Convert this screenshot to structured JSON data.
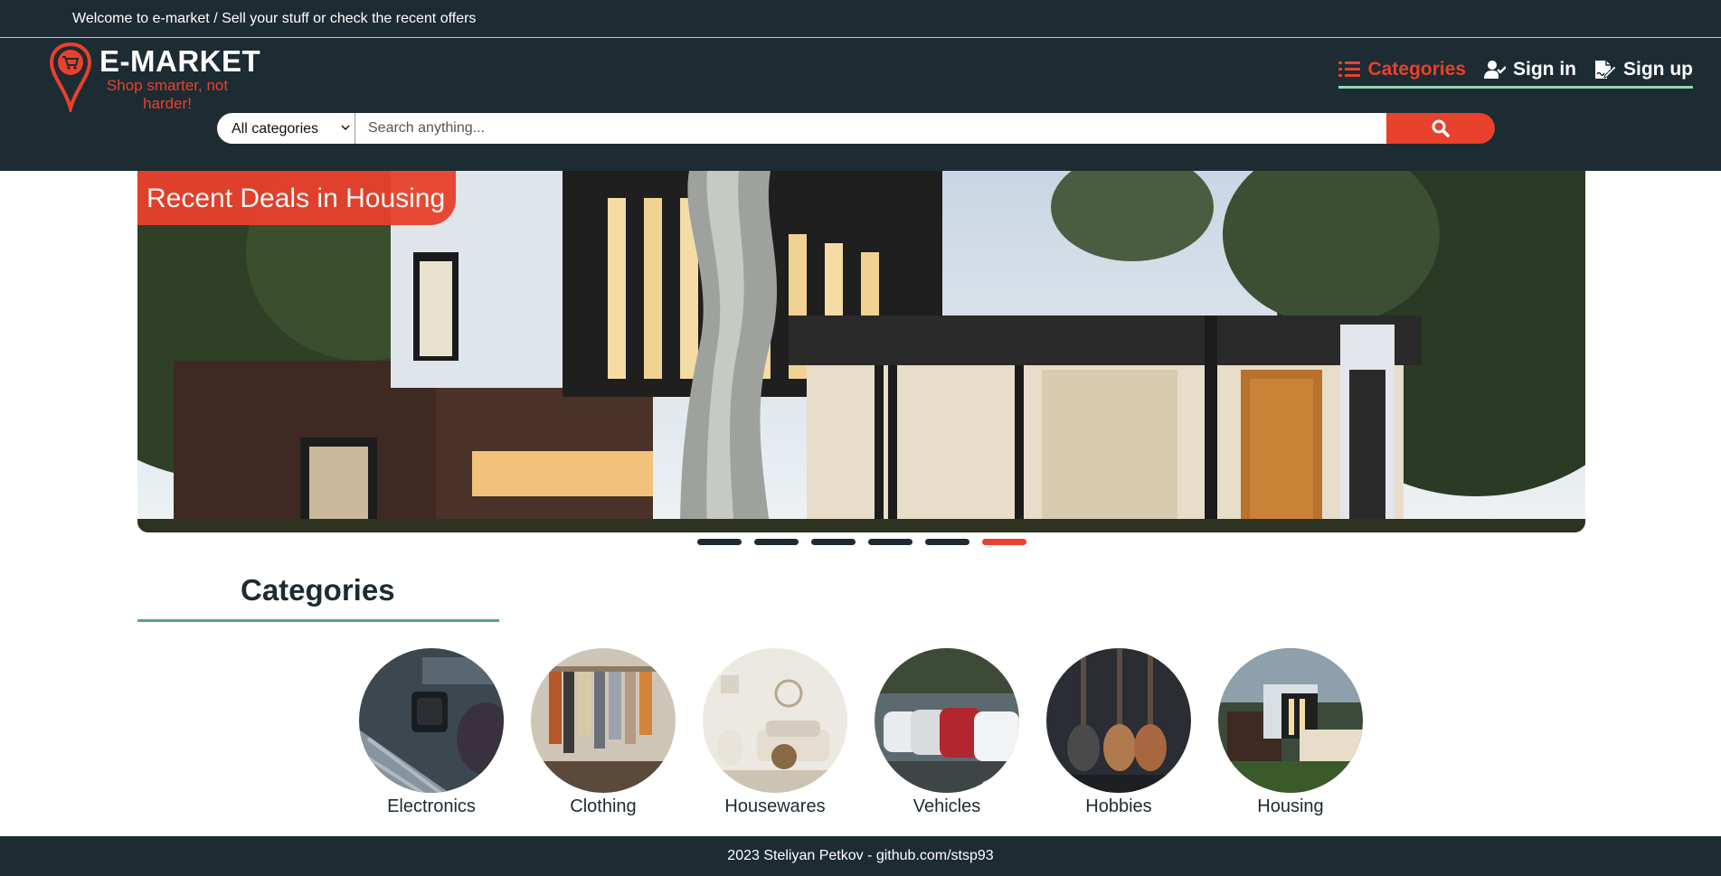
{
  "topbar": {
    "welcome": "Welcome to e-market / Sell your stuff or check the recent offers"
  },
  "logo": {
    "brand": "E-MARKET",
    "tagline": "Shop smarter, not harder!",
    "icon": "map-pin-cart-icon"
  },
  "nav": {
    "categories": {
      "label": "Categories",
      "icon": "list-icon"
    },
    "sign_in": {
      "label": "Sign in",
      "icon": "user-check-icon"
    },
    "sign_up": {
      "label": "Sign up",
      "icon": "signature-icon"
    }
  },
  "search": {
    "category_selected": "All categories",
    "placeholder": "Search anything...",
    "button_icon": "search-icon"
  },
  "hero": {
    "label": "Recent Deals in Housing"
  },
  "carousel": {
    "slide_count": 6,
    "active_index": 5
  },
  "categories": {
    "title": "Categories",
    "items": [
      {
        "name": "Electronics"
      },
      {
        "name": "Clothing"
      },
      {
        "name": "Housewares"
      },
      {
        "name": "Vehicles"
      },
      {
        "name": "Hobbies"
      },
      {
        "name": "Housing"
      }
    ]
  },
  "footer": {
    "text": "2023 Steliyan Petkov - github.com/stsp93"
  },
  "colors": {
    "dark": "#1d2b33",
    "accent": "#e8412c",
    "underline": "#8fd6b6",
    "divider": "#5aa383"
  }
}
